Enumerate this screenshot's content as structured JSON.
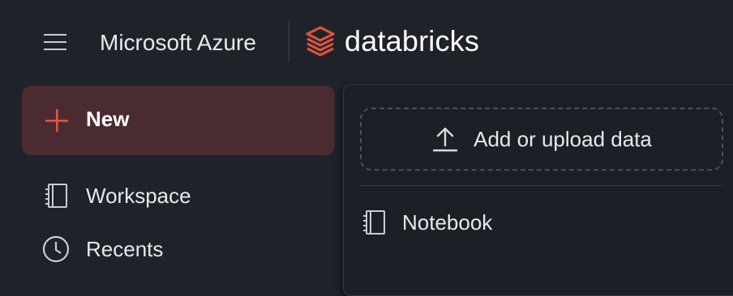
{
  "header": {
    "menu_icon": "hamburger-menu-icon",
    "azure_label": "Microsoft Azure",
    "product_label": "databricks",
    "logo_icon": "databricks-logo-icon",
    "logo_color": "#e0533d"
  },
  "sidebar": {
    "new_button": {
      "label": "New",
      "icon": "plus-icon",
      "accent": "#e5533f",
      "background": "#4a2b30"
    },
    "items": [
      {
        "label": "Workspace",
        "icon": "workspace-icon"
      },
      {
        "label": "Recents",
        "icon": "clock-icon"
      }
    ]
  },
  "new_menu": {
    "upload": {
      "label": "Add or upload data",
      "icon": "upload-icon"
    },
    "items": [
      {
        "label": "Notebook",
        "icon": "notebook-icon"
      }
    ]
  },
  "colors": {
    "background": "#1f2329",
    "panel": "#1c2026",
    "text": "#e6e8eb"
  }
}
